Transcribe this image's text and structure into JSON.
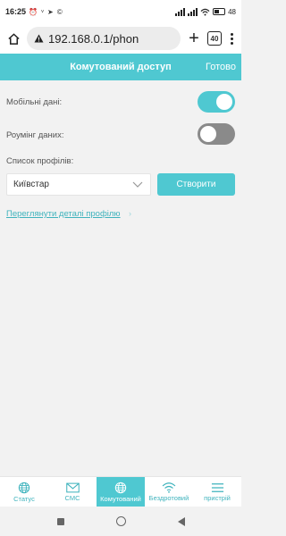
{
  "status_bar": {
    "time": "16:25",
    "left_icons": "⏰ ᵛ ➤ ©",
    "battery": "48",
    "battery_level": 0.48
  },
  "browser": {
    "url": "192.168.0.1/phon",
    "tab_count": "40",
    "new_tab": "+"
  },
  "header": {
    "title": "Комутований доступ",
    "done_label": "Готово"
  },
  "settings": {
    "mobile_data": {
      "label": "Мобільні дані:",
      "enabled": true
    },
    "roaming": {
      "label": "Роумінг даних:",
      "enabled": false
    },
    "profile_list_label": "Список профілів:",
    "profile_selected": "Київстар",
    "create_label": "Створити",
    "details_link": "Переглянути деталі профілю",
    "details_chevron": "›"
  },
  "bottom_nav": {
    "items": [
      {
        "label": "Статус",
        "icon": "globe-icon"
      },
      {
        "label": "СМС",
        "icon": "envelope-icon"
      },
      {
        "label": "Комутований",
        "icon": "globe-icon",
        "active": true
      },
      {
        "label": "Бездротовий",
        "icon": "wifi-icon"
      },
      {
        "label": "пристрій",
        "icon": "menu-icon"
      }
    ]
  },
  "colors": {
    "accent": "#4fc8d1",
    "link": "#3fb3bd",
    "background": "#f2f2f2",
    "toggle_off": "#8a8a8a"
  }
}
